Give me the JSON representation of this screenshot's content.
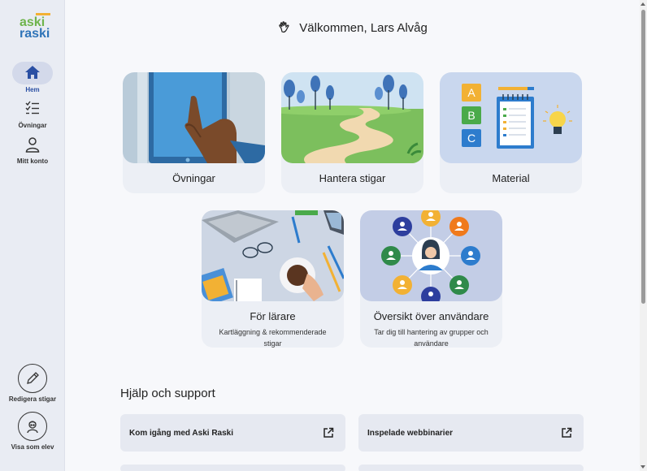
{
  "logo": {
    "line1": "aski",
    "line2": "raski"
  },
  "sidebar": {
    "items": [
      {
        "label": "Hem",
        "icon": "home-icon",
        "active": true
      },
      {
        "label": "Övningar",
        "icon": "checklist-icon",
        "active": false
      },
      {
        "label": "Mitt konto",
        "icon": "user-icon",
        "active": false
      }
    ],
    "bottom": [
      {
        "label": "Redigera stigar",
        "icon": "pencil-icon"
      },
      {
        "label": "Visa som elev",
        "icon": "student-icon"
      }
    ]
  },
  "header": {
    "welcome": "Välkommen, Lars Alvåg",
    "icon": "waving-hand-icon"
  },
  "cards": [
    {
      "title": "Övningar",
      "subtitle": ""
    },
    {
      "title": "Hantera stigar",
      "subtitle": ""
    },
    {
      "title": "Material",
      "subtitle": ""
    },
    {
      "title": "För lärare",
      "subtitle": "Kartläggning & rekommenderade stigar"
    },
    {
      "title": "Översikt över användare",
      "subtitle": "Tar dig till hantering av grupper och användare"
    }
  ],
  "help": {
    "title": "Hjälp och support",
    "links": [
      {
        "label": "Kom igång med Aski Raski",
        "icon": "external-link-icon"
      },
      {
        "label": "Inspelade webbinarier",
        "icon": "external-link-icon"
      }
    ]
  },
  "colors": {
    "accent": "#2a4fa3",
    "sidebar_bg": "#e9ecf3",
    "card_bg": "#eceff5"
  }
}
